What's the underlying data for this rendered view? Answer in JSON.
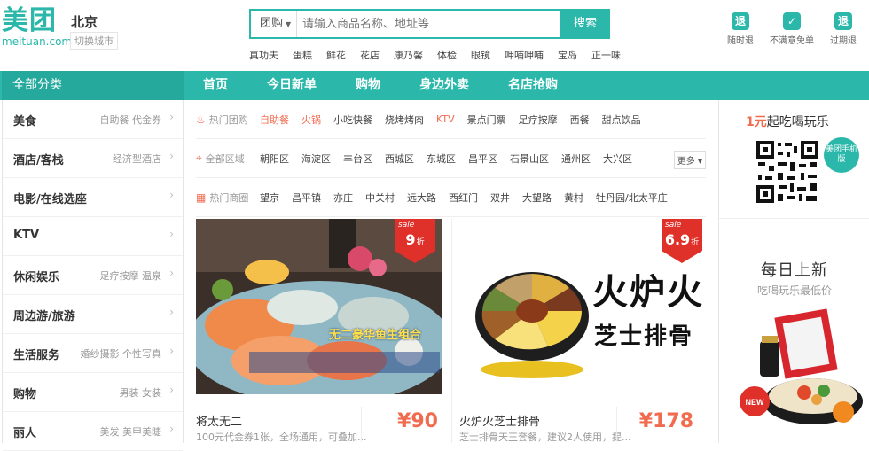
{
  "header": {
    "logo_cn": "美团",
    "logo_en": "meituan.com",
    "city": "北京",
    "switch_city": "切换城市",
    "search": {
      "category": "团购",
      "placeholder": "请输入商品名称、地址等",
      "button": "搜索"
    },
    "hot_words": [
      "真功夫",
      "蛋糕",
      "鲜花",
      "花店",
      "康乃馨",
      "体检",
      "眼镜",
      "呷哺呷哺",
      "宝岛",
      "正一味"
    ],
    "badges": [
      {
        "icon": "退",
        "label": "随时退"
      },
      {
        "icon": "✓",
        "label": "不满意免单"
      },
      {
        "icon": "退",
        "label": "过期退"
      }
    ]
  },
  "nav": {
    "all_categories": "全部分类",
    "items": [
      "首页",
      "今日新单",
      "购物",
      "身边外卖",
      "名店抢购"
    ]
  },
  "sidebar": [
    {
      "title": "美食",
      "sub": "自助餐 代金券"
    },
    {
      "title": "酒店/客栈",
      "sub": "经济型酒店"
    },
    {
      "title": "电影/在线选座",
      "sub": ""
    },
    {
      "title": "KTV",
      "sub": ""
    },
    {
      "title": "休闲娱乐",
      "sub": "足疗按摩 温泉"
    },
    {
      "title": "周边游/旅游",
      "sub": ""
    },
    {
      "title": "生活服务",
      "sub": "婚纱摄影 个性写真"
    },
    {
      "title": "购物",
      "sub": "男装 女装"
    },
    {
      "title": "丽人",
      "sub": "美发 美甲美睫"
    }
  ],
  "filters": {
    "hot_deals": {
      "label": "热门团购",
      "options": [
        "自助餐",
        "火锅",
        "小吃快餐",
        "烧烤烤肉",
        "KTV",
        "景点门票",
        "足疗按摩",
        "西餐",
        "甜点饮品"
      ],
      "highlighted": [
        "自助餐",
        "火锅",
        "KTV"
      ]
    },
    "areas": {
      "label": "全部区域",
      "options": [
        "朝阳区",
        "海淀区",
        "丰台区",
        "西城区",
        "东城区",
        "昌平区",
        "石景山区",
        "通州区",
        "大兴区"
      ],
      "more": "更多"
    },
    "business": {
      "label": "热门商圈",
      "options": [
        "望京",
        "昌平镇",
        "亦庄",
        "中关村",
        "远大路",
        "西红门",
        "双井",
        "大望路",
        "黄村",
        "牡丹园/北太平庄"
      ]
    }
  },
  "deals": [
    {
      "name": "将太无二",
      "desc": "100元代金券1张，全场通用，可叠加...",
      "price": "¥90",
      "sale_word": "sale",
      "discount": "9",
      "discount_unit": "折",
      "image_caption": "无二豪华鱼生组合"
    },
    {
      "name": "火炉火芝士排骨",
      "desc": "芝士排骨天王套餐，建议2人使用，提...",
      "price": "¥178",
      "sale_word": "sale",
      "discount": "6.9",
      "discount_unit": "折",
      "logo_text": "火炉火",
      "logo_sub": "芝士排骨"
    }
  ],
  "right_panel": {
    "promo_number": "1元",
    "promo_rest": "起吃喝玩乐",
    "mobile_badge": "美团手机版",
    "daily_title": "每日上新",
    "daily_sub": "吃喝玩乐最低价",
    "new_badge": "NEW"
  },
  "colors": {
    "brand": "#2bb8aa",
    "accent": "#f16b4f",
    "sale_red": "#e0302a"
  }
}
